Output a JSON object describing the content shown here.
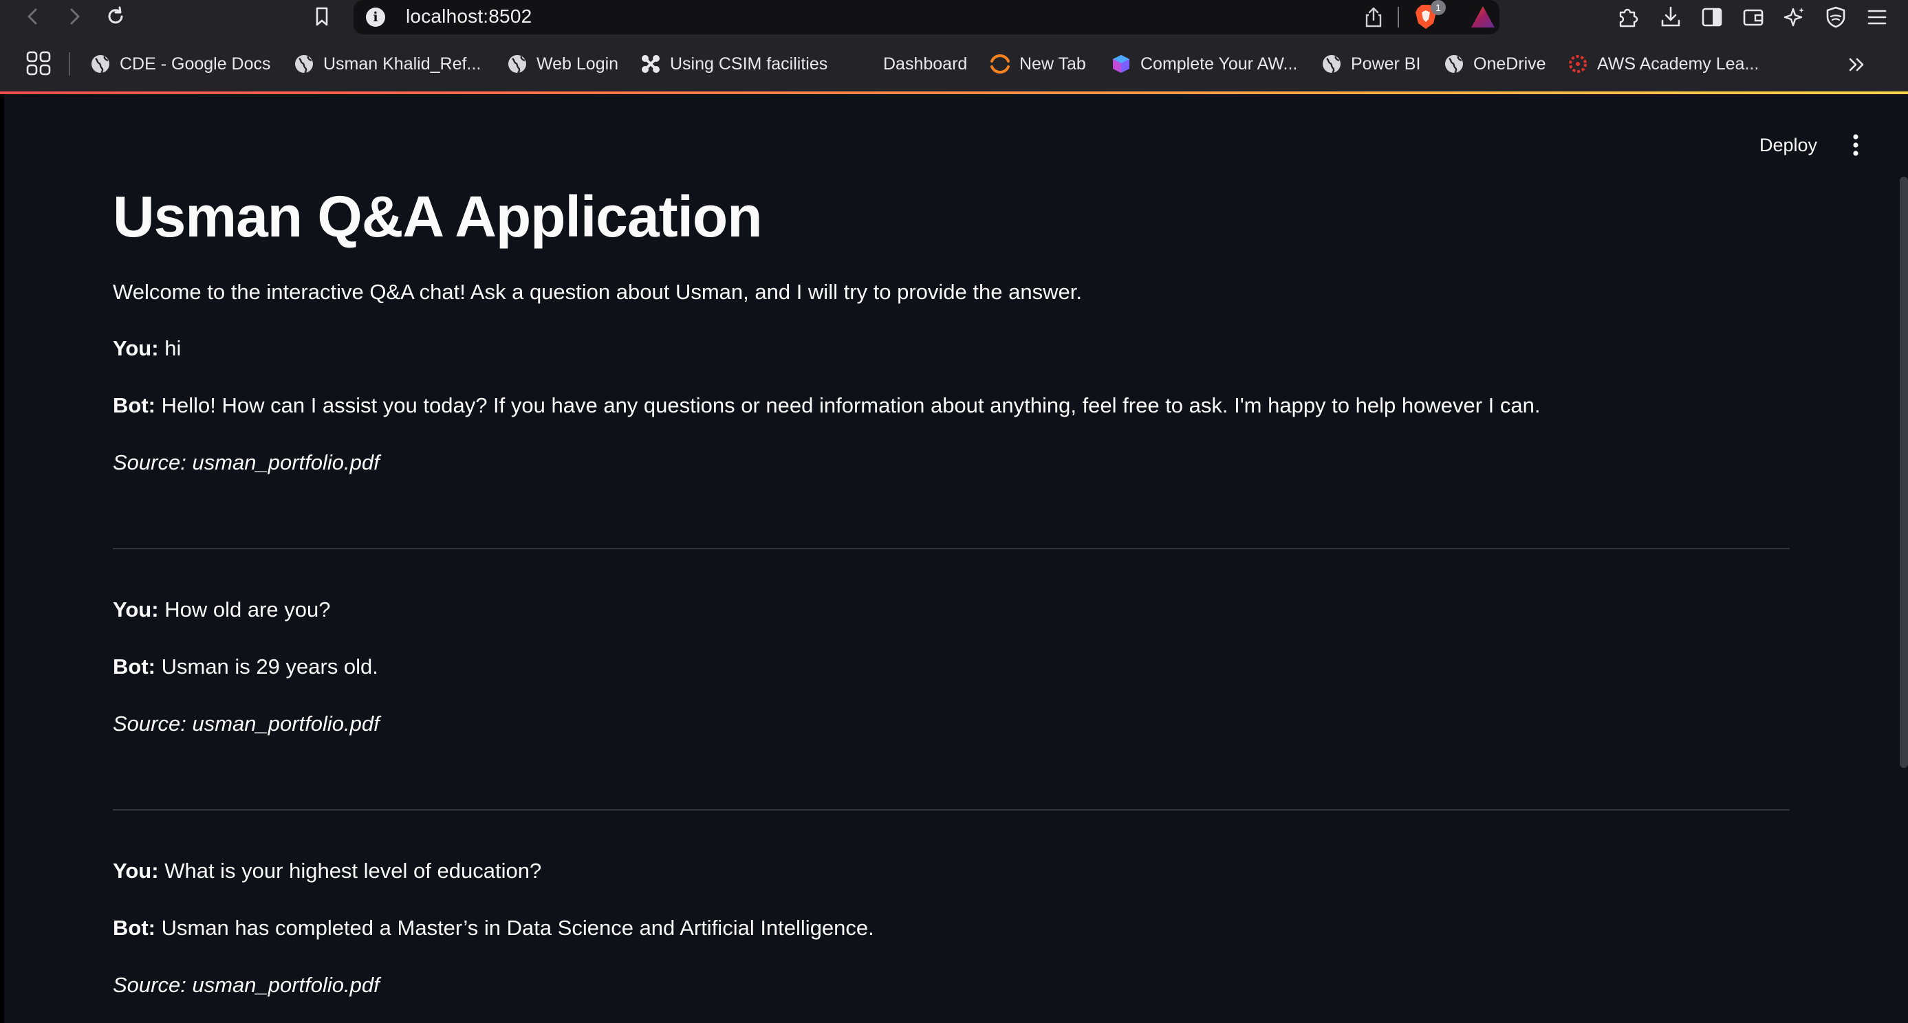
{
  "browser": {
    "url": "localhost:8502",
    "shield_badge": "1",
    "bookmarks": [
      {
        "label": "CDE - Google Docs",
        "icon": "globe-icon"
      },
      {
        "label": "Usman Khalid_Ref...",
        "icon": "globe-icon"
      },
      {
        "label": "Web Login",
        "icon": "globe-icon"
      },
      {
        "label": "Using CSIM facilities",
        "icon": "joomla-icon"
      },
      {
        "label": "Dashboard",
        "icon": "blank-icon"
      },
      {
        "label": "New Tab",
        "icon": "loading-icon"
      },
      {
        "label": "Complete Your AW...",
        "icon": "cube-icon"
      },
      {
        "label": "Power BI",
        "icon": "globe-icon"
      },
      {
        "label": "OneDrive",
        "icon": "globe-icon"
      },
      {
        "label": "AWS Academy Lea...",
        "icon": "aws-academy-icon"
      }
    ]
  },
  "app": {
    "deploy_label": "Deploy",
    "title": "Usman Q&A Application",
    "welcome": "Welcome to the interactive Q&A chat! Ask a question about Usman, and I will try to provide the answer.",
    "you_label": "You:",
    "bot_label": "Bot:",
    "messages": [
      {
        "question": "hi",
        "answer": "Hello! How can I assist you today? If you have any questions or need information about anything, feel free to ask. I'm happy to help however I can.",
        "source": "Source: usman_portfolio.pdf"
      },
      {
        "question": "How old are you?",
        "answer": "Usman is 29 years old.",
        "source": "Source: usman_portfolio.pdf"
      },
      {
        "question": "What is your highest level of education?",
        "answer": "Usman has completed a Master’s in Data Science and Artificial Intelligence.",
        "source": "Source: usman_portfolio.pdf"
      }
    ]
  },
  "colors": {
    "background": "#0e1117",
    "chrome": "#242428",
    "accent_gradient_start": "#ff4b4b",
    "accent_gradient_end": "#ffd54b",
    "divider": "#31333f"
  }
}
